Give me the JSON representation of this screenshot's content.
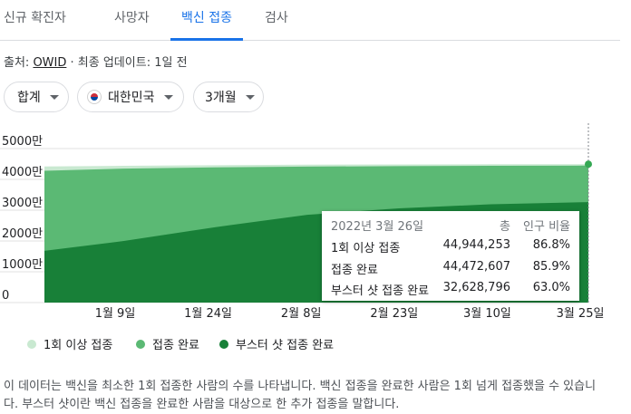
{
  "tabs": [
    {
      "label": "신규 확진자"
    },
    {
      "label": "사망자"
    },
    {
      "label": "백신 접종"
    },
    {
      "label": "검사"
    }
  ],
  "source": {
    "prefix": "출처:",
    "link": "OWID",
    "updated": "· 최종 업데이트: 1일 전"
  },
  "filters": {
    "metric": "합계",
    "country": "대한민국",
    "period": "3개월"
  },
  "tooltip": {
    "date": "2022년 3월 26일",
    "col_total": "총",
    "col_pct": "인구 비율",
    "rows": [
      {
        "label": "1회 이상 접종",
        "total": "44,944,253",
        "pct": "86.8%"
      },
      {
        "label": "접종 완료",
        "total": "44,472,607",
        "pct": "85.9%"
      },
      {
        "label": "부스터 샷 접종 완료",
        "total": "32,628,796",
        "pct": "63.0%"
      }
    ]
  },
  "legend": [
    "1회 이상 접종",
    "접종 완료",
    "부스터 샷 접종 완료"
  ],
  "description": "이 데이터는 백신을 최소한 1회 접종한 사람의 수를 나타냅니다. 백신 접종을 완료한 사람은 1회 넘게 접종했을 수 있습니다. 부스터 샷이란 백신 접종을 완료한 사람을 대상으로 한 추가 접종을 말합니다.",
  "chart_data": {
    "type": "area",
    "x_tick_labels": [
      "1월 9일",
      "1월 24일",
      "2월 8일",
      "2월 23일",
      "3월 10일",
      "3월 25일"
    ],
    "y_tick_labels": [
      "0",
      "1000만",
      "2000만",
      "3000만",
      "4000만",
      "5000만"
    ],
    "ylim": [
      0,
      50000000
    ],
    "x": [
      "2021-12-27",
      "2022-01-09",
      "2022-01-24",
      "2022-02-08",
      "2022-02-23",
      "2022-03-10",
      "2022-03-26"
    ],
    "series": [
      {
        "name": "1회 이상 접종",
        "color": "#c9e9d1",
        "values": [
          44200000,
          44400000,
          44600000,
          44750000,
          44850000,
          44900000,
          44944253
        ]
      },
      {
        "name": "접종 완료",
        "color": "#5bb974",
        "values": [
          42800000,
          43500000,
          43900000,
          44150000,
          44300000,
          44400000,
          44472607
        ]
      },
      {
        "name": "부스터 샷 접종 완료",
        "color": "#188038",
        "values": [
          16800000,
          20000000,
          24500000,
          28500000,
          30600000,
          31900000,
          32628796
        ]
      }
    ],
    "grid": true
  }
}
